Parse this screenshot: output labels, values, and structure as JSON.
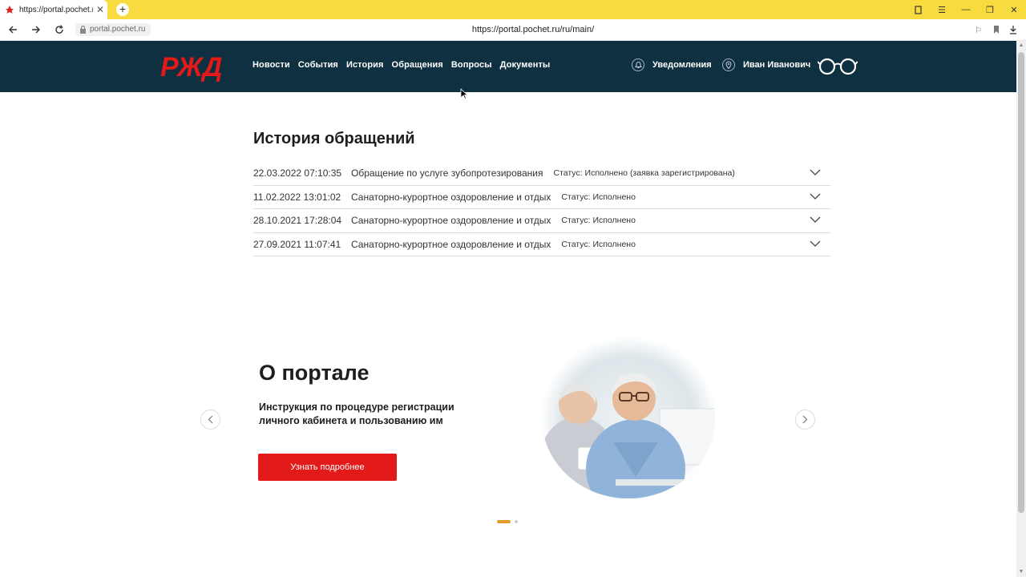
{
  "browser": {
    "tab_title": "https://portal.pochet.ru",
    "site_chip": "portal.pochet.ru",
    "url": "https://portal.pochet.ru/ru/main/"
  },
  "header": {
    "logo_text": "РЖД",
    "nav": [
      "Новости",
      "События",
      "История",
      "Обращения",
      "Вопросы",
      "Документы"
    ],
    "notifications_label": "Уведомления",
    "user_name": "Иван Иванович"
  },
  "history": {
    "title": "История обращений",
    "rows": [
      {
        "date": "22.03.2022 07:10:35",
        "service": "Обращение по услуге зубопротезирования",
        "status": "Статус: Исполнено (заявка зарегистрирована)"
      },
      {
        "date": "11.02.2022 13:01:02",
        "service": "Санаторно-курортное оздоровление и отдых",
        "status": "Статус: Исполнено"
      },
      {
        "date": "28.10.2021 17:28:04",
        "service": "Санаторно-курортное оздоровление и отдых",
        "status": "Статус: Исполнено"
      },
      {
        "date": "27.09.2021 11:07:41",
        "service": "Санаторно-курортное оздоровление и отдых",
        "status": "Статус: Исполнено"
      }
    ]
  },
  "about": {
    "title": "О портале",
    "subtitle": "Инструкция по процедуре регистрации личного кабинета и пользованию им",
    "button_label": "Узнать подробнее",
    "slide_index": 1,
    "slide_count": 2
  },
  "colors": {
    "header_bg": "#0f3040",
    "brand_red": "#e21a1a",
    "tab_bar": "#f8dc3f",
    "dot_active": "#e7992c"
  }
}
